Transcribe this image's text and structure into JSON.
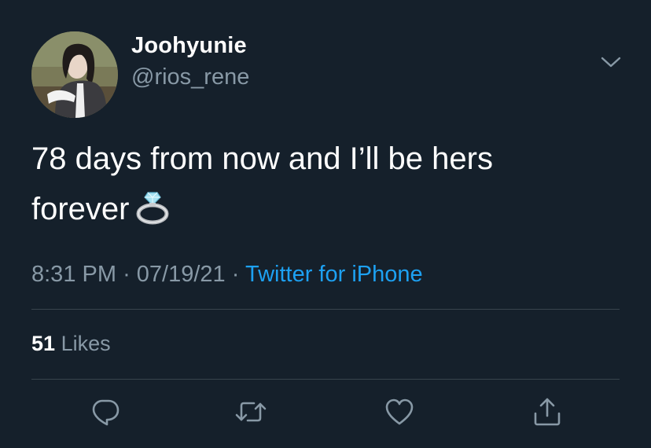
{
  "user": {
    "display_name": "Joohyunie",
    "handle": "@rios_rene"
  },
  "tweet": {
    "text_line1": "78 days from now and I’ll be hers",
    "text_line2": "forever",
    "emoji": "ring-emoji"
  },
  "meta": {
    "time": "8:31 PM",
    "separator": "·",
    "date": "07/19/21",
    "source": "Twitter for iPhone"
  },
  "stats": {
    "likes_count": "51",
    "likes_label": "Likes"
  },
  "icons": {
    "caret": "chevron-down-icon",
    "reply": "reply-icon",
    "retweet": "retweet-icon",
    "like": "heart-icon",
    "share": "share-icon"
  },
  "colors": {
    "background": "#15202b",
    "primary_text": "#ffffff",
    "secondary_text": "#8899a6",
    "link": "#1da1f2",
    "divider": "#38444d"
  }
}
